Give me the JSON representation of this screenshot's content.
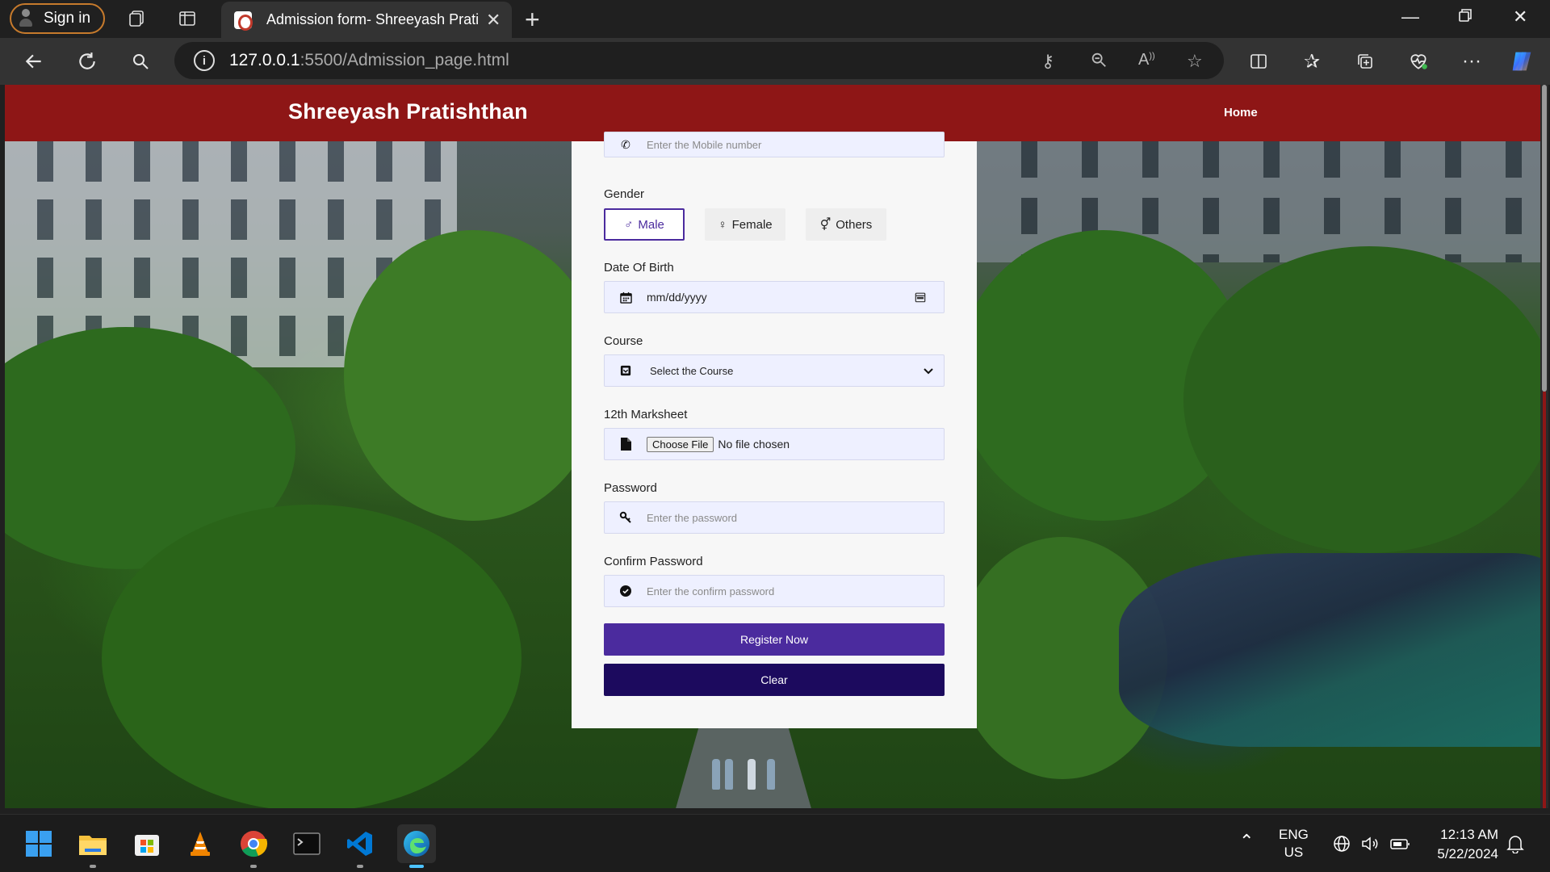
{
  "browser": {
    "signin_label": "Sign in",
    "tab_title": "Admission form- Shreeyash Prati",
    "url_host": "127.0.0.1",
    "url_path": ":5500/Admission_page.html"
  },
  "site": {
    "brand": "Shreeyash Pratishthan",
    "nav_home": "Home"
  },
  "form": {
    "mobile_placeholder": "Enter the Mobile number",
    "gender_label": "Gender",
    "gender_options": [
      "Male",
      "Female",
      "Others"
    ],
    "gender_selected": "Male",
    "dob_label": "Date Of Birth",
    "dob_value": "mm/dd/yyyy",
    "course_label": "Course",
    "course_value": "Select the Course",
    "marksheet_label": "12th Marksheet",
    "choose_file": "Choose File",
    "no_file": "No file chosen",
    "password_label": "Password",
    "password_placeholder": "Enter the password",
    "confirm_label": "Confirm Password",
    "confirm_placeholder": "Enter the confirm password",
    "register_button": "Register Now",
    "clear_button": "Clear"
  },
  "taskbar": {
    "lang_line1": "ENG",
    "lang_line2": "US",
    "time": "12:13 AM",
    "date": "5/22/2024"
  },
  "colors": {
    "header": "#8e1616",
    "register": "#4b2b9e",
    "clear": "#1c0a5e"
  }
}
